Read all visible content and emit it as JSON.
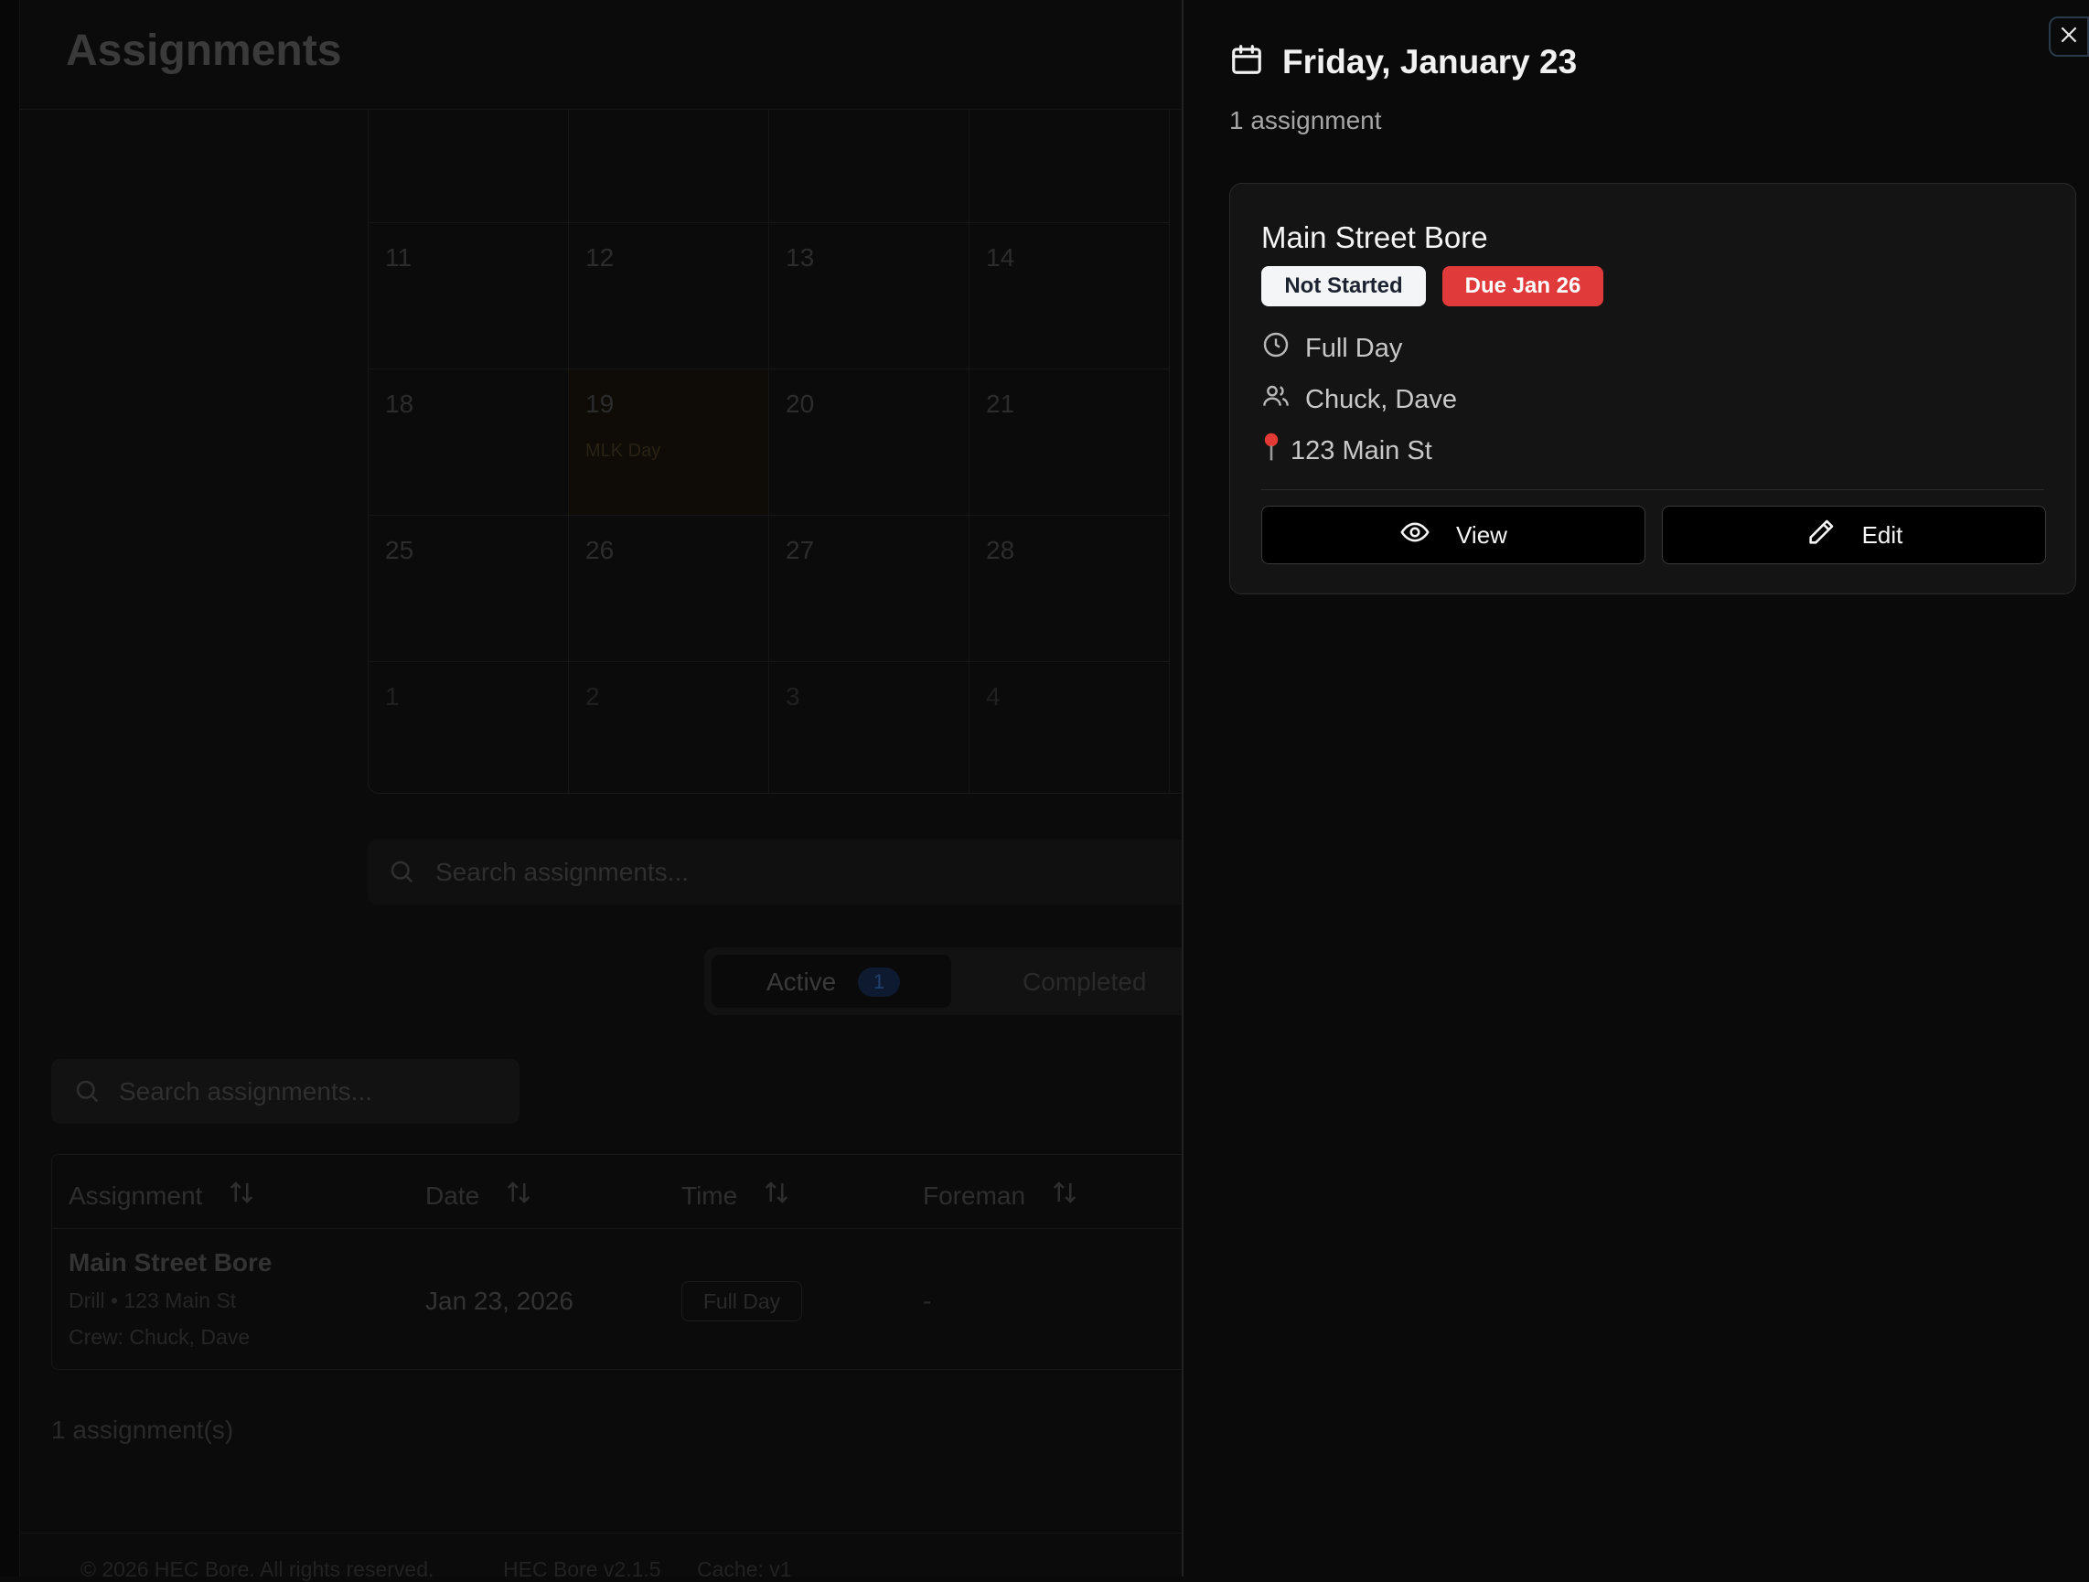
{
  "page": {
    "title": "Assignments"
  },
  "calendar": {
    "weeks": [
      [
        "11",
        "12",
        "13",
        "14"
      ],
      [
        "18",
        "19",
        "20",
        "21"
      ],
      [
        "25",
        "26",
        "27",
        "28"
      ],
      [
        "1",
        "2",
        "3",
        "4"
      ]
    ],
    "holiday": {
      "day": "19",
      "label": "MLK Day"
    }
  },
  "search_top": {
    "placeholder": "Search assignments..."
  },
  "tabs": {
    "active_label": "Active",
    "active_count": "1",
    "completed_label": "Completed"
  },
  "search_bottom": {
    "placeholder": "Search assignments..."
  },
  "table": {
    "columns": [
      "Assignment",
      "Date",
      "Time",
      "Foreman"
    ],
    "rows": [
      {
        "name": "Main Street Bore",
        "meta": "Drill • 123 Main St",
        "crew": "Crew: Chuck, Dave",
        "date": "Jan 23, 2026",
        "time": "Full Day",
        "foreman": "-"
      }
    ]
  },
  "count_label": "1 assignment(s)",
  "footer": {
    "copyright": "© 2026 HEC Bore. All rights reserved.",
    "version": "HEC Bore v2.1.5",
    "cache": "Cache: v1"
  },
  "drawer": {
    "title": "Friday, January 23",
    "subtitle": "1 assignment",
    "card": {
      "title": "Main Street Bore",
      "status": "Not Started",
      "due": "Due Jan 26",
      "time": "Full Day",
      "crew": "Chuck, Dave",
      "location": "123 Main St",
      "view_label": "View",
      "edit_label": "Edit"
    }
  },
  "colors": {
    "background": "#0a0a0a",
    "card": "#141414",
    "due_badge": "#e03a3a",
    "status_badge": "#f4f5f7"
  }
}
